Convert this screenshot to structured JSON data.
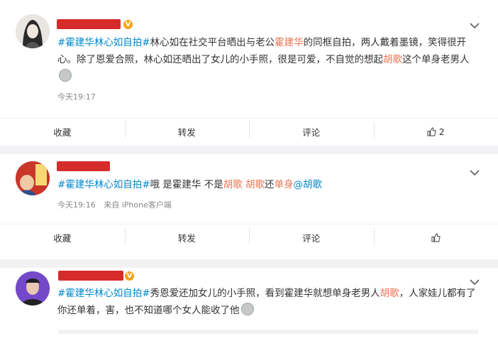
{
  "post1": {
    "text_part1": "#霍建华林心如自拍#",
    "text_part2": "林心如在社交平台晒出与老公",
    "mention1": "霍建华",
    "text_part3": "的同框自拍，两人戴着墨镜，笑得很开心。除了恩爱合照，林心如还晒出了女儿的小手照，很是可爱，不自觉的想起",
    "mention2": "胡歌",
    "text_part4": "这个单身老男人",
    "time": "今天19:17",
    "actions": {
      "collect": "收藏",
      "repost": "转发",
      "comment": "评论",
      "like_count": "2"
    }
  },
  "post2": {
    "text_part1": "#霍建华林心如自拍#",
    "text_part2": "哦 是霍建华 不是",
    "mention1": "胡歌",
    "space": " ",
    "mention2": "胡歌",
    "text_part3": "还",
    "mention3": "单身",
    "mention4": "@胡歌",
    "time": "今天19:16",
    "source": "来自 iPhone客户端",
    "actions": {
      "collect": "收藏",
      "repost": "转发",
      "comment": "评论",
      "like_count": ""
    }
  },
  "post3": {
    "text_part1": "#霍建华林心如自拍#",
    "text_part2": "秀恩爱还加女儿的小手照，看到霍建华就想单身老男人",
    "mention1": "胡歌",
    "text_part3": "，人家娃儿都有了你还单着，害，也不知道哪个女人能收了他"
  },
  "icons": {
    "chevron": "chevron-down-icon",
    "like": "thumbs-up-icon",
    "verified": "verified-badge-icon"
  },
  "colors": {
    "hashtag": "#eb7350",
    "mention": "#eb7350",
    "link": "#0088cc",
    "verified": "#f4a21b"
  }
}
